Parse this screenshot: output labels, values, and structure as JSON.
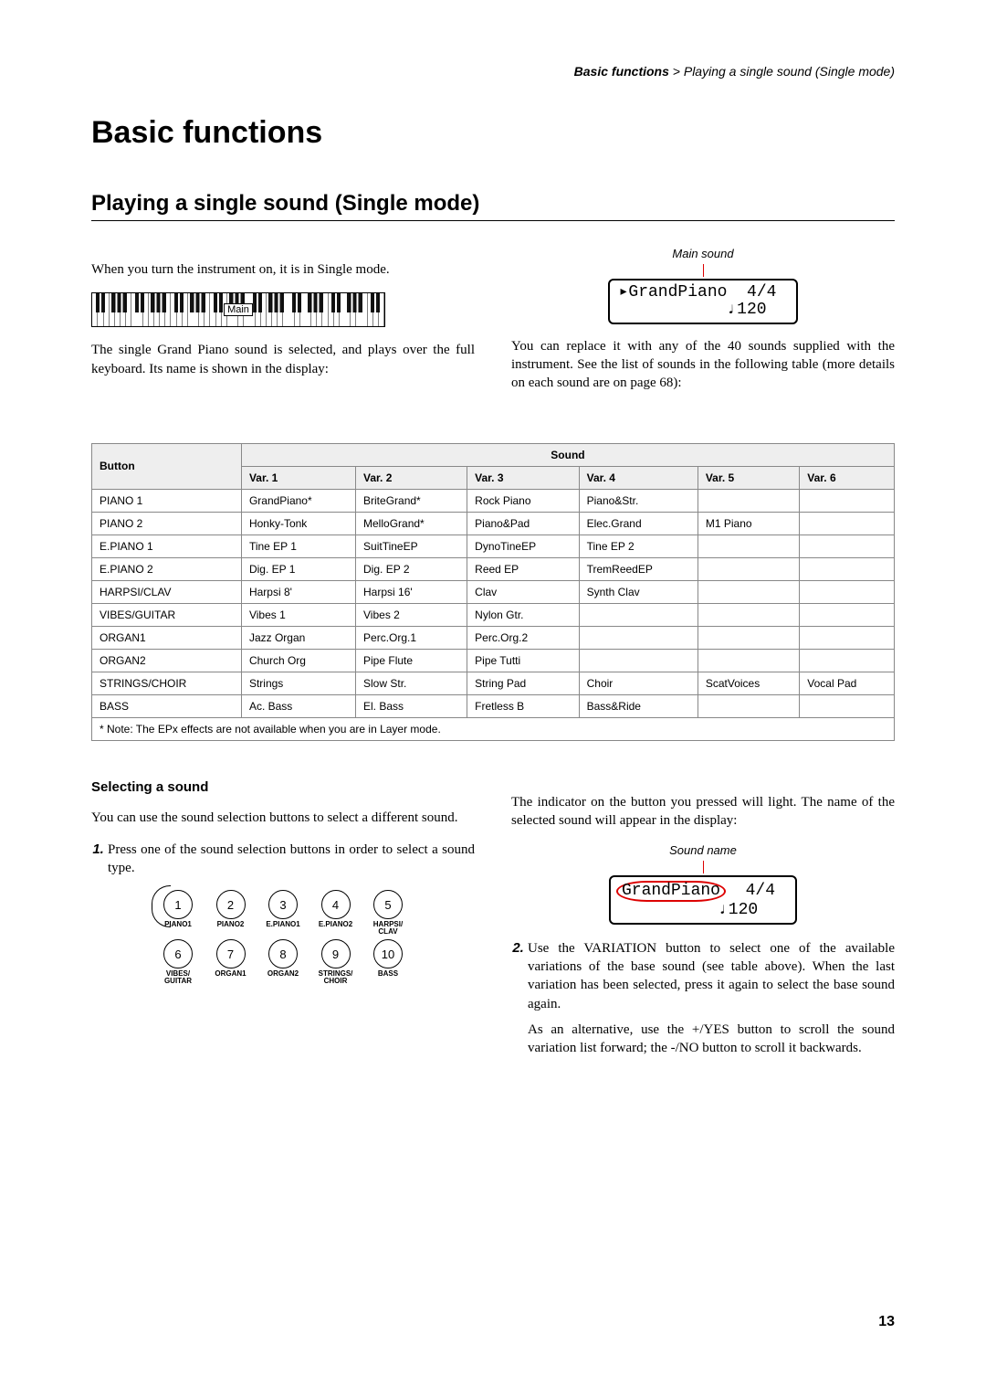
{
  "breadcrumb": {
    "bold": "Basic functions",
    "rest": " > Playing a single sound (Single mode)"
  },
  "h1": "Basic functions",
  "h2": "Playing a single sound (Single mode)",
  "intro1": "When you turn the instrument on, it is in Single mode.",
  "keyboard_label": "Main",
  "intro2": "The single Grand Piano sound is selected, and plays over the full keyboard. Its name is shown in the display:",
  "lcd1_caption": "Main sound",
  "lcd1_line1_left": "▸GrandPiano",
  "lcd1_line1_right": "4/4",
  "lcd1_line2": "           ♩120",
  "right_intro": "You can replace it with any of the 40 sounds supplied with the instrument. See the list of sounds in the following table (more details on each sound are on page 68):",
  "table": {
    "header_button": "Button",
    "header_sound": "Sound",
    "var_labels": [
      "Var. 1",
      "Var. 2",
      "Var. 3",
      "Var. 4",
      "Var. 5",
      "Var. 6"
    ],
    "rows": [
      {
        "btn": "PIANO 1",
        "cells": [
          "GrandPiano*",
          "BriteGrand*",
          "Rock Piano",
          "Piano&Str.",
          "",
          ""
        ]
      },
      {
        "btn": "PIANO 2",
        "cells": [
          "Honky-Tonk",
          "MelloGrand*",
          "Piano&Pad",
          "Elec.Grand",
          "M1 Piano",
          ""
        ]
      },
      {
        "btn": "E.PIANO 1",
        "cells": [
          "Tine EP 1",
          "SuitTineEP",
          "DynoTineEP",
          "Tine EP 2",
          "",
          ""
        ]
      },
      {
        "btn": "E.PIANO 2",
        "cells": [
          "Dig. EP 1",
          "Dig. EP 2",
          "Reed EP",
          "TremReedEP",
          "",
          ""
        ]
      },
      {
        "btn": "HARPSI/CLAV",
        "cells": [
          "Harpsi 8'",
          "Harpsi 16'",
          "Clav",
          "Synth Clav",
          "",
          ""
        ]
      },
      {
        "btn": "VIBES/GUITAR",
        "cells": [
          "Vibes 1",
          "Vibes 2",
          "Nylon Gtr.",
          "",
          "",
          ""
        ]
      },
      {
        "btn": "ORGAN1",
        "cells": [
          "Jazz Organ",
          "Perc.Org.1",
          "Perc.Org.2",
          "",
          "",
          ""
        ]
      },
      {
        "btn": "ORGAN2",
        "cells": [
          "Church Org",
          "Pipe Flute",
          "Pipe Tutti",
          "",
          "",
          ""
        ]
      },
      {
        "btn": "STRINGS/CHOIR",
        "cells": [
          "Strings",
          "Slow Str.",
          "String Pad",
          "Choir",
          "ScatVoices",
          "Vocal Pad"
        ]
      },
      {
        "btn": "BASS",
        "cells": [
          "Ac. Bass",
          "El. Bass",
          "Fretless B",
          "Bass&Ride",
          "",
          ""
        ]
      }
    ],
    "note": "* Note: The EPx effects are not available when you are in Layer mode."
  },
  "h3": "Selecting a sound",
  "sel_intro": "You can use the sound selection buttons to select a different sound.",
  "step1": "Press one of the sound selection buttons in order to select a sound type.",
  "buttons": [
    [
      {
        "n": "1",
        "l": "PIANO1"
      },
      {
        "n": "2",
        "l": "PIANO2"
      },
      {
        "n": "3",
        "l": "E.PIANO1"
      },
      {
        "n": "4",
        "l": "E.PIANO2"
      },
      {
        "n": "5",
        "l": "HARPSI/\nCLAV"
      }
    ],
    [
      {
        "n": "6",
        "l": "VIBES/\nGUITAR"
      },
      {
        "n": "7",
        "l": "ORGAN1"
      },
      {
        "n": "8",
        "l": "ORGAN2"
      },
      {
        "n": "9",
        "l": "STRINGS/\nCHOIR"
      },
      {
        "n": "10",
        "l": "BASS"
      }
    ]
  ],
  "right_step_intro": "The indicator on the button you pressed will light. The name of the selected sound will appear in the display:",
  "lcd2_caption": "Sound name",
  "lcd2_name": "GrandPiano",
  "lcd2_right": "4/4",
  "lcd2_line2": "          ♩120",
  "step2": "Use the VARIATION button to select one of the available variations of the base sound (see table above). When the last variation has been selected, press it again to select the base sound again.",
  "step2b": "As an alternative, use the +/YES button to scroll the sound variation list forward; the -/NO button to scroll it backwards.",
  "page_number": "13"
}
